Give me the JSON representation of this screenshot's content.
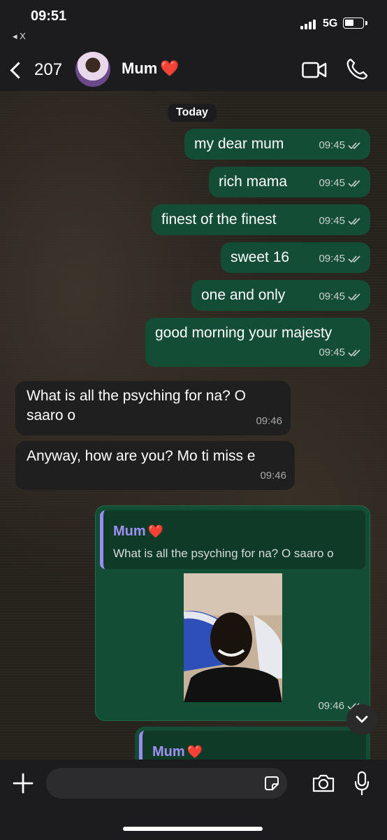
{
  "status_bar": {
    "time": "09:51",
    "back_app": "◂ X",
    "network": "5G"
  },
  "header": {
    "back_count": "207",
    "contact_name": "Mum",
    "contact_emoji": "❤️"
  },
  "chat": {
    "date_separator": "Today",
    "messages": [
      {
        "dir": "out",
        "text": "my dear mum",
        "time": "09:45"
      },
      {
        "dir": "out",
        "text": "rich mama",
        "time": "09:45"
      },
      {
        "dir": "out",
        "text": "finest of the finest",
        "time": "09:45"
      },
      {
        "dir": "out",
        "text": "sweet 16",
        "time": "09:45"
      },
      {
        "dir": "out",
        "text": "one and only",
        "time": "09:45"
      },
      {
        "dir": "out",
        "text": "good morning your majesty",
        "time": "09:45"
      },
      {
        "dir": "in",
        "text": "What is all the psyching for na? O saaro o",
        "time": "09:46"
      },
      {
        "dir": "in",
        "text": "Anyway, how are you? Mo ti miss e",
        "time": "09:46"
      }
    ],
    "reply_photo": {
      "quote_name": "Mum",
      "quote_emoji": "❤️",
      "quote_text": "What is all the psyching for na? O saaro o",
      "time": "09:46"
    },
    "partial_reply": {
      "quote_name": "Mum",
      "quote_emoji": "❤️"
    }
  },
  "colors": {
    "outgoing": "#144d35",
    "incoming": "#1f1f1f",
    "quote_accent": "#9b8cf0"
  },
  "icons": [
    "video-call-icon",
    "phone-icon",
    "plus-icon",
    "sticker-icon",
    "camera-icon",
    "microphone-icon",
    "chevron-down-icon",
    "double-check-icon"
  ]
}
